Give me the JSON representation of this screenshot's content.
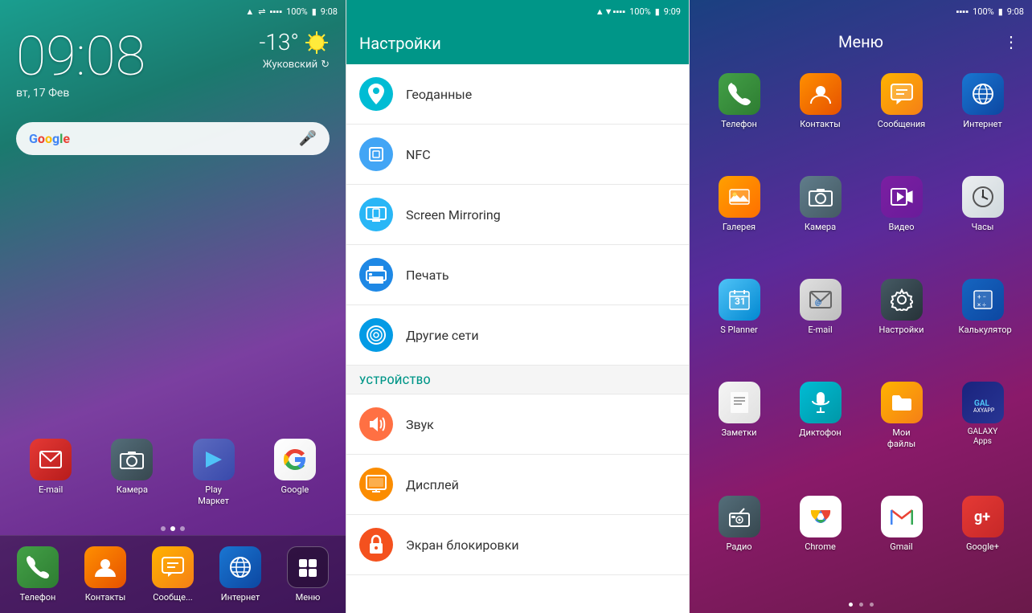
{
  "panel1": {
    "status": {
      "time": "9:08",
      "battery": "100%",
      "signal": "▲▼"
    },
    "clock": "09:08",
    "date": "вт, 17 Фев",
    "weather": {
      "temp": "-13°",
      "city": "Жуковский"
    },
    "search_placeholder": "Google",
    "dock_apps": [
      {
        "label": "E-mail",
        "icon": "email"
      },
      {
        "label": "Камера",
        "icon": "camera"
      },
      {
        "label": "Play Маркет",
        "icon": "play"
      },
      {
        "label": "Google",
        "icon": "google"
      }
    ],
    "bottom_apps": [
      {
        "label": "Телефон",
        "icon": "phone"
      },
      {
        "label": "Контакты",
        "icon": "contacts"
      },
      {
        "label": "Сообще...",
        "icon": "sms"
      },
      {
        "label": "Интернет",
        "icon": "browser"
      },
      {
        "label": "Меню",
        "icon": "menu"
      }
    ]
  },
  "panel2": {
    "status": {
      "time": "9:09",
      "battery": "100%"
    },
    "title": "Настройки",
    "items": [
      {
        "label": "Геоданные",
        "icon": "location",
        "color": "teal"
      },
      {
        "label": "NFC",
        "icon": "nfc",
        "color": "blue"
      },
      {
        "label": "Screen Mirroring",
        "icon": "screen",
        "color": "blue2"
      },
      {
        "label": "Печать",
        "icon": "print",
        "color": "blue3"
      },
      {
        "label": "Другие сети",
        "icon": "network",
        "color": "blue4"
      }
    ],
    "section_label": "УСТРОЙСТВО",
    "device_items": [
      {
        "label": "Звук",
        "icon": "sound",
        "color": "orange"
      },
      {
        "label": "Дисплей",
        "icon": "display",
        "color": "orange2"
      },
      {
        "label": "Экран блокировки",
        "icon": "lock",
        "color": "orange3"
      }
    ]
  },
  "panel3": {
    "status": {
      "time": "9:08",
      "battery": "100%"
    },
    "title": "Меню",
    "apps": [
      {
        "label": "Телефон",
        "icon": "phone-green"
      },
      {
        "label": "Контакты",
        "icon": "contacts-orange"
      },
      {
        "label": "Сообщения",
        "icon": "sms-yellow"
      },
      {
        "label": "Интернет",
        "icon": "internet-blue"
      },
      {
        "label": "Галерея",
        "icon": "gallery-orange"
      },
      {
        "label": "Камера",
        "icon": "camera-gray"
      },
      {
        "label": "Видео",
        "icon": "video-purple"
      },
      {
        "label": "Часы",
        "icon": "clock-white"
      },
      {
        "label": "S Planner",
        "icon": "splanner"
      },
      {
        "label": "E-mail",
        "icon": "email2"
      },
      {
        "label": "Настройки",
        "icon": "settings2"
      },
      {
        "label": "Калькулятор",
        "icon": "calc"
      },
      {
        "label": "Заметки",
        "icon": "notes"
      },
      {
        "label": "Диктофон",
        "icon": "recorder"
      },
      {
        "label": "Мои файлы",
        "icon": "myfiles"
      },
      {
        "label": "GALAXY Apps",
        "icon": "galaxyapps"
      },
      {
        "label": "Радио",
        "icon": "radio"
      },
      {
        "label": "Chrome",
        "icon": "chrome"
      },
      {
        "label": "Gmail",
        "icon": "gmail"
      },
      {
        "label": "Google+",
        "icon": "gplus"
      }
    ],
    "menu_icon": "⋮"
  }
}
